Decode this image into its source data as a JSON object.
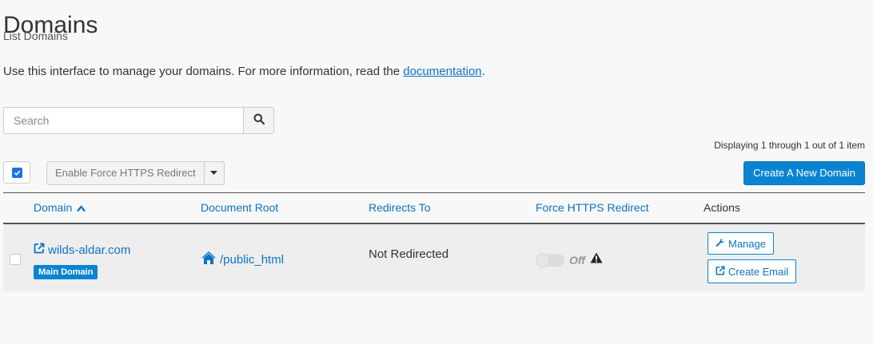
{
  "header": {
    "title": "Domains",
    "subtitle": "List Domains"
  },
  "intro": {
    "text": "Use this interface to manage your domains. For more information, read the ",
    "link_label": "documentation",
    "suffix": "."
  },
  "search": {
    "placeholder": "Search",
    "button_icon": "search-icon"
  },
  "pagination": {
    "summary": "Displaying 1 through 1 out of 1 item"
  },
  "toolbar": {
    "bulk_checkbox_checked": true,
    "bulk_action_label": "Enable Force HTTPS Redirect",
    "create_button_label": "Create A New Domain"
  },
  "table": {
    "columns": [
      {
        "label": "Domain",
        "sortable": true,
        "sort": "ascending"
      },
      {
        "label": "Document Root",
        "sortable": true
      },
      {
        "label": "Redirects To",
        "sortable": true
      },
      {
        "label": "Force HTTPS Redirect",
        "sortable": true
      },
      {
        "label": "Actions",
        "sortable": false
      }
    ],
    "rows": [
      {
        "domain": "wilds-aldar.com",
        "badge": "Main Domain",
        "document_root": "/public_html",
        "redirects_to": "Not Redirected",
        "force_https": "Off",
        "warning_icon": "warning-icon",
        "actions": {
          "manage": "Manage",
          "create_email": "Create Email"
        }
      }
    ]
  },
  "colors": {
    "accent": "#0a84d0",
    "link": "#0a74c4",
    "row_background": "#eeeeee",
    "page_background": "#f8f8f8"
  }
}
